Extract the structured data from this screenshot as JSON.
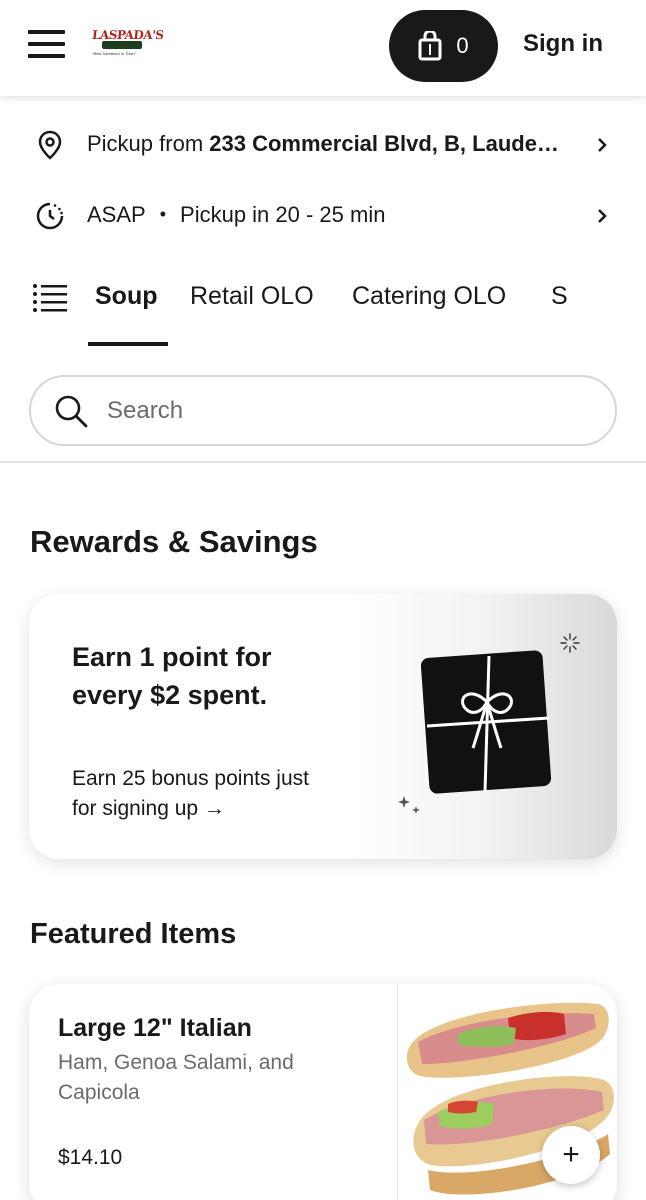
{
  "header": {
    "brand_name": "LASPADA'S",
    "brand_sub": "ORIGINAL HOAGIES",
    "brand_tagline": "\"Best Sandwich in Town\"",
    "cart_count": "0",
    "sign_in_label": "Sign in",
    "icons": {
      "menu": "hamburger-icon",
      "cart": "shopping-bag-icon"
    }
  },
  "pickup": {
    "prefix": "Pickup from ",
    "address": "233 Commercial Blvd, B, Laude…",
    "icon": "location-pin-icon"
  },
  "timing": {
    "asap": "ASAP",
    "eta": "Pickup in 20 - 25 min",
    "icon": "clock-icon"
  },
  "tabs": [
    "Soup",
    "Retail OLO",
    "Catering OLO",
    "S"
  ],
  "active_tab": "Soup",
  "search": {
    "placeholder": "Search",
    "value": ""
  },
  "rewards": {
    "section_title": "Rewards & Savings",
    "headline": "Earn 1 point for every $2 spent.",
    "subtext": "Earn 25 bonus points just for signing up →",
    "icon": "gift-icon"
  },
  "featured": {
    "section_title": "Featured Items",
    "items": [
      {
        "name": "Large 12\" Italian",
        "description": "Ham, Genoa Salami, and Capicola",
        "price": "$14.10",
        "add_label": "+"
      }
    ]
  },
  "colors": {
    "text": "#191919",
    "muted": "#6b6b6b",
    "button_dark": "#191919",
    "border": "#d6d6d6",
    "brand_red": "#b3241c"
  }
}
